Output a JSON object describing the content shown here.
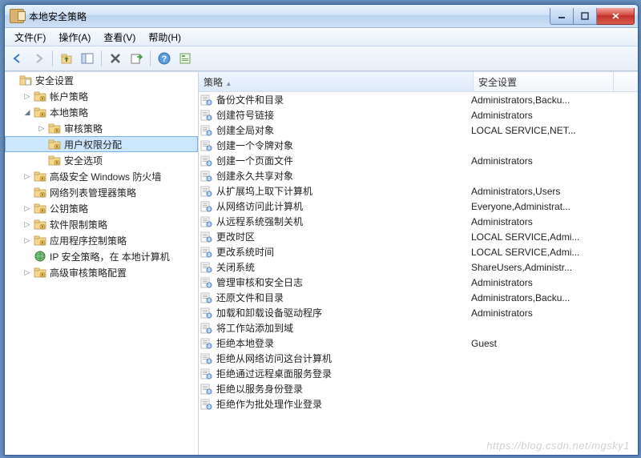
{
  "window": {
    "title": "本地安全策略"
  },
  "menu": {
    "file": "文件(F)",
    "action": "操作(A)",
    "view": "查看(V)",
    "help": "帮助(H)"
  },
  "tree": {
    "root": "安全设置",
    "items": [
      {
        "label": "帐户策略",
        "expand": "▷"
      },
      {
        "label": "本地策略",
        "expand": "◢",
        "children": [
          {
            "label": "审核策略",
            "expand": "▷"
          },
          {
            "label": "用户权限分配",
            "selected": true
          },
          {
            "label": "安全选项"
          }
        ]
      },
      {
        "label": "高级安全 Windows 防火墙",
        "expand": "▷"
      },
      {
        "label": "网络列表管理器策略"
      },
      {
        "label": "公钥策略",
        "expand": "▷"
      },
      {
        "label": "软件限制策略",
        "expand": "▷"
      },
      {
        "label": "应用程序控制策略",
        "expand": "▷"
      },
      {
        "label": "IP 安全策略，在 本地计算机",
        "iptype": true
      },
      {
        "label": "高级审核策略配置",
        "expand": "▷"
      }
    ]
  },
  "columns": {
    "policy": "策略",
    "setting": "安全设置"
  },
  "rows": [
    {
      "p": "备份文件和目录",
      "s": "Administrators,Backu..."
    },
    {
      "p": "创建符号链接",
      "s": "Administrators"
    },
    {
      "p": "创建全局对象",
      "s": "LOCAL SERVICE,NET..."
    },
    {
      "p": "创建一个令牌对象",
      "s": ""
    },
    {
      "p": "创建一个页面文件",
      "s": "Administrators"
    },
    {
      "p": "创建永久共享对象",
      "s": ""
    },
    {
      "p": "从扩展坞上取下计算机",
      "s": "Administrators,Users"
    },
    {
      "p": "从网络访问此计算机",
      "s": "Everyone,Administrat..."
    },
    {
      "p": "从远程系统强制关机",
      "s": "Administrators"
    },
    {
      "p": "更改时区",
      "s": "LOCAL SERVICE,Admi..."
    },
    {
      "p": "更改系统时间",
      "s": "LOCAL SERVICE,Admi..."
    },
    {
      "p": "关闭系统",
      "s": "ShareUsers,Administr..."
    },
    {
      "p": "管理审核和安全日志",
      "s": "Administrators"
    },
    {
      "p": "还原文件和目录",
      "s": "Administrators,Backu..."
    },
    {
      "p": "加载和卸载设备驱动程序",
      "s": "Administrators"
    },
    {
      "p": "将工作站添加到域",
      "s": ""
    },
    {
      "p": "拒绝本地登录",
      "s": "Guest"
    },
    {
      "p": "拒绝从网络访问这台计算机",
      "s": ""
    },
    {
      "p": "拒绝通过远程桌面服务登录",
      "s": ""
    },
    {
      "p": "拒绝以服务身份登录",
      "s": ""
    },
    {
      "p": "拒绝作为批处理作业登录",
      "s": ""
    }
  ],
  "watermark": "https://blog.csdn.net/mgsky1"
}
